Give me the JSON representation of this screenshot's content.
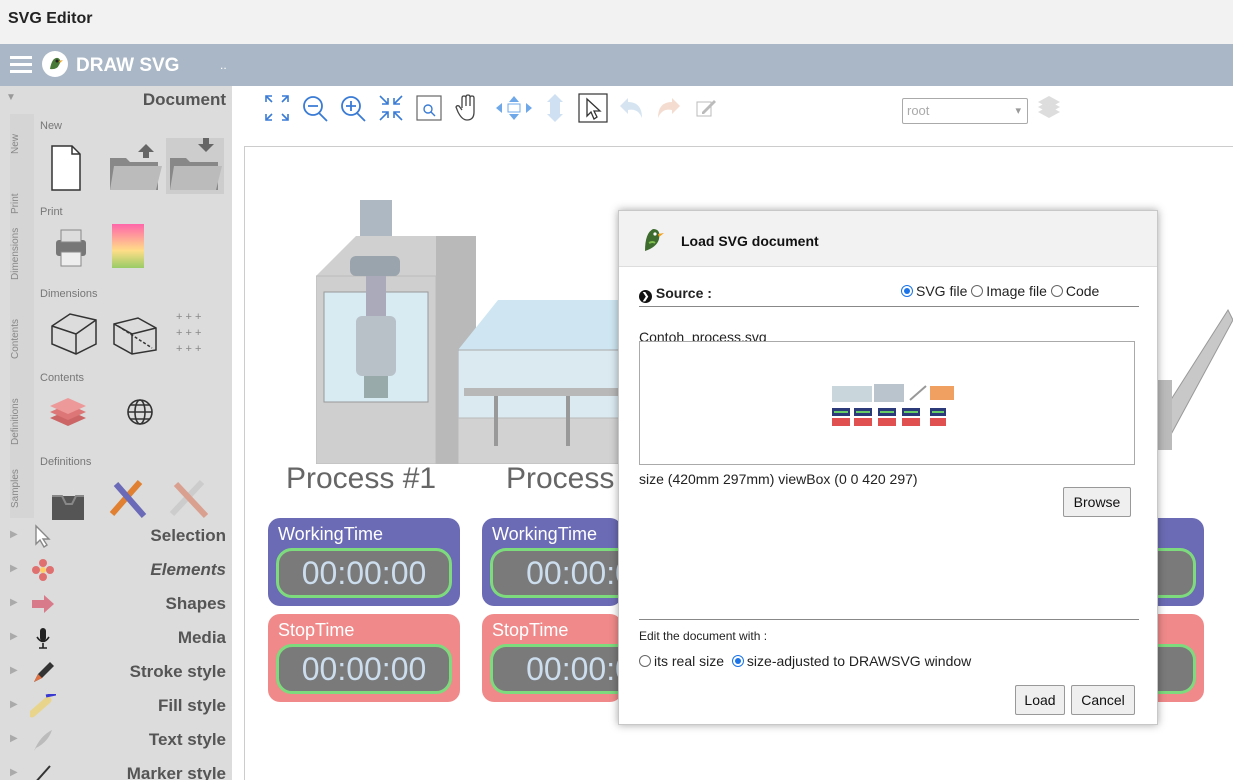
{
  "app": {
    "title": "SVG Editor",
    "brand": "DRAW SVG",
    "brand_extra": ".."
  },
  "sidebar": {
    "header": "Document",
    "vtabs": [
      "New",
      "Print",
      "Dimensions",
      "Contents",
      "Definitions",
      "Samples"
    ],
    "sections": [
      "New",
      "Print",
      "Dimensions",
      "Contents",
      "Definitions"
    ],
    "menu": [
      {
        "label": "Selection",
        "icon": "pointer-icon"
      },
      {
        "label": "Elements",
        "icon": "flower-icon"
      },
      {
        "label": "Shapes",
        "icon": "arrow-shape-icon"
      },
      {
        "label": "Media",
        "icon": "microphone-icon"
      },
      {
        "label": "Stroke style",
        "icon": "pen-icon"
      },
      {
        "label": "Fill style",
        "icon": "paint-roller-icon"
      },
      {
        "label": "Text style",
        "icon": "feather-icon"
      },
      {
        "label": "Marker style",
        "icon": "marker-icon"
      }
    ]
  },
  "toolbar": {
    "element_select": "root"
  },
  "canvas": {
    "process_labels": [
      "Process #1",
      "Process"
    ],
    "cards": [
      {
        "title": "WorkingTime",
        "time": "00:00:00"
      },
      {
        "title": "WorkingTime",
        "time": "00:00:0"
      },
      {
        "title": "StopTime",
        "time": "00:00:00"
      },
      {
        "title": "StopTime",
        "time": "00:00:0"
      }
    ]
  },
  "dialog": {
    "title": "Load SVG document",
    "source_label": "Source :",
    "source_options": [
      "SVG file",
      "Image file",
      "Code"
    ],
    "source_selected": "SVG file",
    "filename": "Contoh_process.svg",
    "size_info": "size (420mm 297mm) viewBox (0 0 420 297)",
    "browse": "Browse",
    "edit_label": "Edit the document with :",
    "edit_options": [
      "its real size",
      "size-adjusted to DRAWSVG window"
    ],
    "edit_selected": "size-adjusted to DRAWSVG window",
    "load": "Load",
    "cancel": "Cancel"
  },
  "colors": {
    "navbar": "#a9b7c6",
    "card_blue": "#6b6bb5",
    "card_red": "#f08a8a",
    "timer_border": "#7ddb7d",
    "radio_accent": "#1a73e8"
  }
}
